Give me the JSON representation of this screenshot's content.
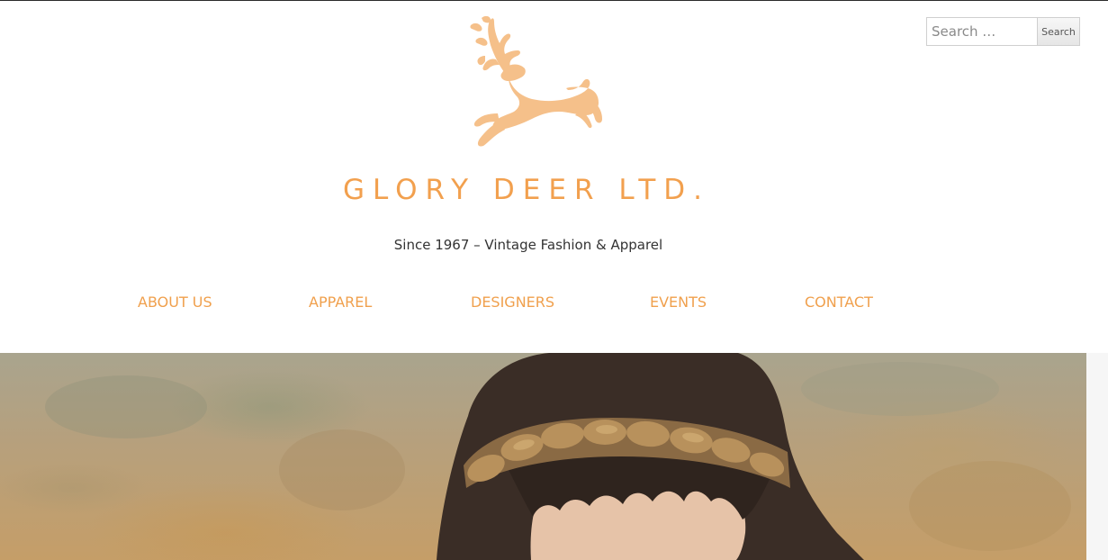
{
  "site": {
    "title": "GLORY DEER LTD.",
    "tagline": "Since 1967 – Vintage Fashion & Apparel",
    "logo_icon": "leaping-deer-icon",
    "brand_color": "#f5c08a",
    "accent_color": "#f0a04d"
  },
  "search": {
    "placeholder": "Search …",
    "button_label": "Search"
  },
  "nav": {
    "items": [
      {
        "label": "ABOUT US"
      },
      {
        "label": "APPAREL"
      },
      {
        "label": "DESIGNERS"
      },
      {
        "label": "EVENTS"
      },
      {
        "label": "CONTACT"
      }
    ]
  },
  "hero": {
    "image": "woman-with-beaded-headband-photo"
  }
}
